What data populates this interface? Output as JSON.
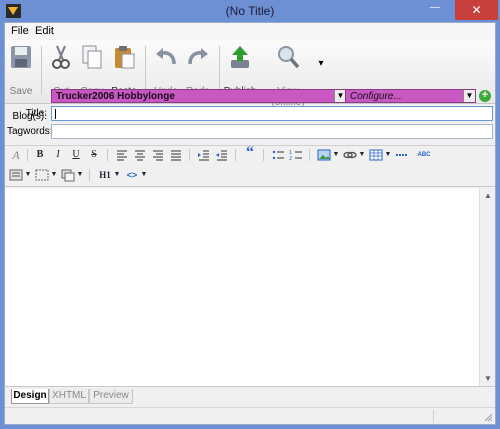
{
  "window": {
    "title": "(No Title)",
    "controls": {
      "minimize": "—",
      "maximize": "☐",
      "close": "✕"
    }
  },
  "menu": {
    "items": [
      "File",
      "Edit"
    ]
  },
  "toolbar": {
    "save": "Save",
    "cut": "Cut",
    "copy": "Copy",
    "paste": "Paste",
    "undo": "Undo",
    "redo": "Redo",
    "publish": "Publish",
    "view_online": "View (online)",
    "more": "▾"
  },
  "fields": {
    "blogs_label": "Blog(s):",
    "blog_value": "Trucker2006 Hobbylonge",
    "configure_value": "Configure...",
    "add_icon": "add-icon",
    "title_label": "Title:",
    "title_value": "",
    "tagwords_label": "Tagwords:",
    "tagwords_value": ""
  },
  "format_toolbar": {
    "row1": {
      "clear_format": "A",
      "bold": "B",
      "italic": "I",
      "underline": "U",
      "strike": "S",
      "quote": "“",
      "spellcheck": "ABC"
    },
    "row2": {
      "heading": "H1",
      "code": "<>"
    }
  },
  "tabs": {
    "design": "Design",
    "xhtml": "XHTML",
    "preview": "Preview",
    "active": "Design"
  },
  "colors": {
    "titlebar": "#6d8fd3",
    "close_button": "#c7403b",
    "blog_select": "#c858c2",
    "add_button": "#3da83b",
    "publish_arrow": "#2e9d2e"
  }
}
